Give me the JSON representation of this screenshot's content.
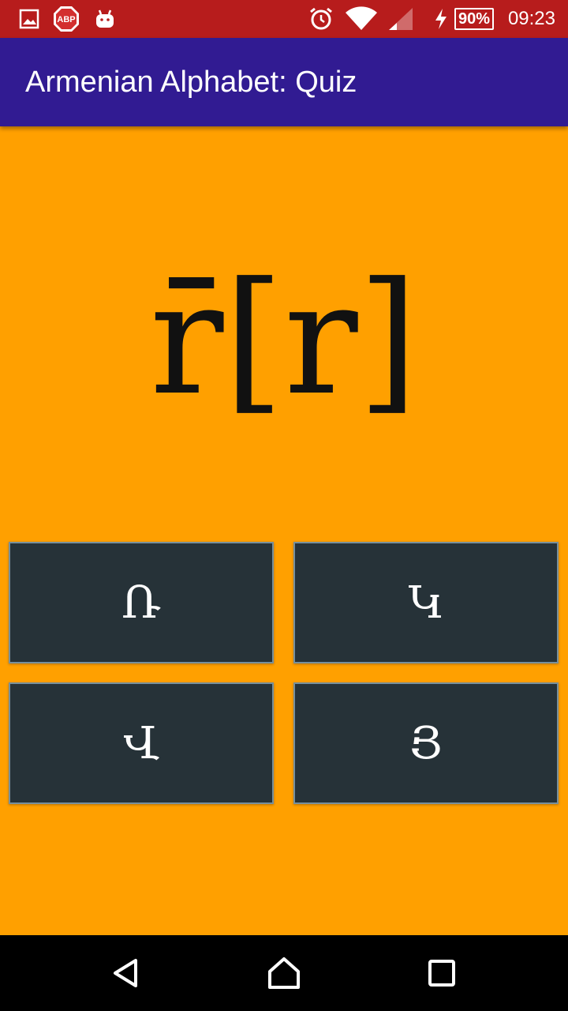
{
  "status_bar": {
    "time": "09:23",
    "battery": "90%",
    "icons": [
      "image-icon",
      "adblock-icon",
      "android-icon",
      "alarm-icon",
      "wifi-icon",
      "signal-icon",
      "charging-icon",
      "battery-icon"
    ],
    "adblock_label": "ABP",
    "background": "#B71C1C"
  },
  "app_bar": {
    "title": "Armenian Alphabet: Quiz",
    "background": "#311B92"
  },
  "question": {
    "text": "r̄[r]"
  },
  "answers": [
    {
      "label": "Ռ"
    },
    {
      "label": "Կ"
    },
    {
      "label": "Վ"
    },
    {
      "label": "Յ"
    }
  ],
  "colors": {
    "background": "#FFA000",
    "button": "#263238",
    "button_border": "#78909C"
  },
  "nav_bar": {
    "items": [
      "back-icon",
      "home-icon",
      "recents-icon"
    ]
  }
}
